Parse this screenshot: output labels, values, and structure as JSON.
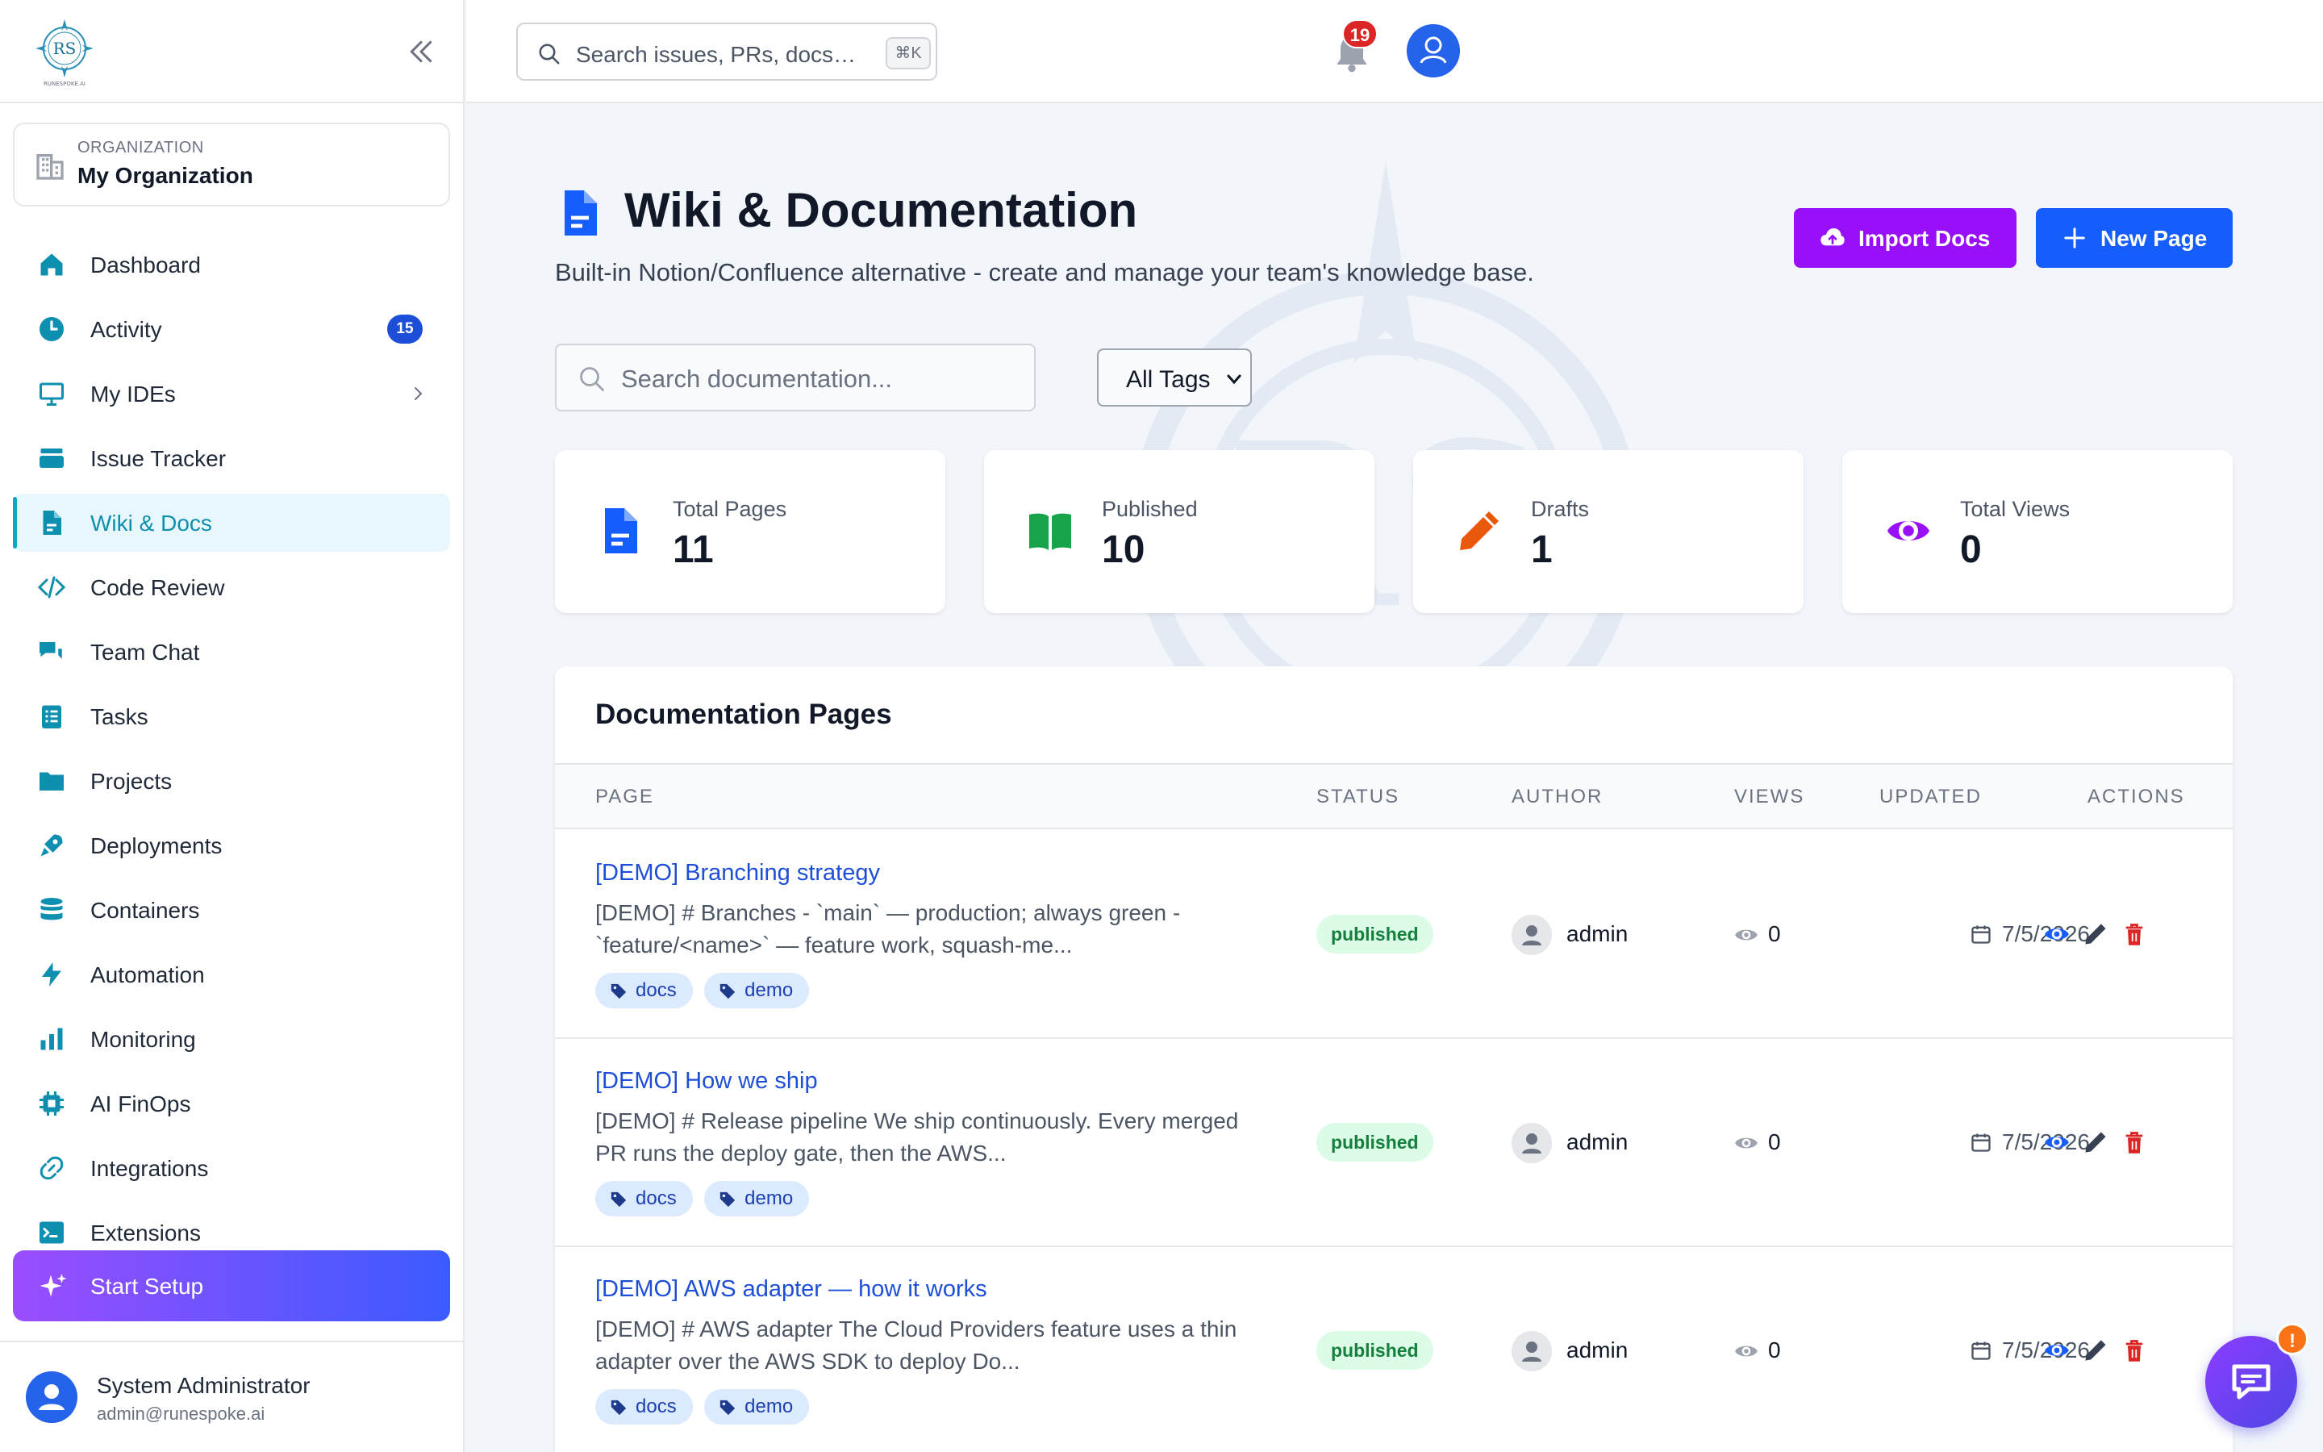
{
  "sidebar": {
    "logo_text": "RUNESPOKE.AI",
    "org": {
      "kicker": "ORGANIZATION",
      "name": "My Organization"
    },
    "items": [
      {
        "label": "Dashboard",
        "icon": "home-icon"
      },
      {
        "label": "Activity",
        "icon": "clock-icon",
        "badge": "15"
      },
      {
        "label": "My IDEs",
        "icon": "monitor-icon"
      },
      {
        "label": "Issue Tracker",
        "icon": "layers-icon"
      },
      {
        "label": "Wiki & Docs",
        "icon": "document-icon",
        "active": true
      },
      {
        "label": "Code Review",
        "icon": "code-icon"
      },
      {
        "label": "Team Chat",
        "icon": "chat-icon"
      },
      {
        "label": "Tasks",
        "icon": "tasks-icon"
      },
      {
        "label": "Projects",
        "icon": "folder-icon"
      },
      {
        "label": "Deployments",
        "icon": "rocket-icon"
      },
      {
        "label": "Containers",
        "icon": "database-icon"
      },
      {
        "label": "Automation",
        "icon": "bolt-icon"
      },
      {
        "label": "Monitoring",
        "icon": "bar-chart-icon"
      },
      {
        "label": "AI FinOps",
        "icon": "chip-icon"
      },
      {
        "label": "Integrations",
        "icon": "link-icon"
      },
      {
        "label": "Extensions",
        "icon": "terminal-icon"
      }
    ],
    "start_setup": "Start Setup",
    "user": {
      "name": "System Administrator",
      "email": "admin@runespoke.ai"
    }
  },
  "topbar": {
    "search_placeholder": "Search issues, PRs, docs…",
    "shortcut": "⌘K",
    "notifications": "19"
  },
  "page": {
    "title": "Wiki & Documentation",
    "subtitle": "Built-in Notion/Confluence alternative - create and manage your team's knowledge base.",
    "import_label": "Import Docs",
    "new_label": "New Page",
    "search_placeholder": "Search documentation...",
    "tag_filter": "All Tags"
  },
  "stats": [
    {
      "label": "Total Pages",
      "value": "11",
      "icon": "document-icon",
      "color": "#155dfc"
    },
    {
      "label": "Published",
      "value": "10",
      "icon": "book-icon",
      "color": "#16a34a"
    },
    {
      "label": "Drafts",
      "value": "1",
      "icon": "pencil-icon",
      "color": "#ea580c"
    },
    {
      "label": "Total Views",
      "value": "0",
      "icon": "eye-icon",
      "color": "#9810fa"
    }
  ],
  "table": {
    "title": "Documentation Pages",
    "headers": {
      "page": "PAGE",
      "status": "STATUS",
      "author": "AUTHOR",
      "views": "VIEWS",
      "updated": "UPDATED",
      "actions": "ACTIONS"
    },
    "rows": [
      {
        "title": "[DEMO] Branching strategy",
        "excerpt": "[DEMO] # Branches - `main` — production; always green - `feature/<name>` — feature work, squash-me...",
        "tags": [
          "docs",
          "demo"
        ],
        "status": "published",
        "author": "admin",
        "views": "0",
        "updated": "7/5/2026"
      },
      {
        "title": "[DEMO] How we ship",
        "excerpt": "[DEMO] # Release pipeline We ship continuously. Every merged PR runs the deploy gate, then the AWS...",
        "tags": [
          "docs",
          "demo"
        ],
        "status": "published",
        "author": "admin",
        "views": "0",
        "updated": "7/5/2026"
      },
      {
        "title": "[DEMO] AWS adapter — how it works",
        "excerpt": "[DEMO] # AWS adapter The Cloud Providers feature uses a thin adapter over the AWS SDK to deploy Do...",
        "tags": [
          "docs",
          "demo"
        ],
        "status": "published",
        "author": "admin",
        "views": "0",
        "updated": "7/5/2026"
      }
    ]
  },
  "chat_badge": "!",
  "colors": {
    "accent": "#0ea5c6",
    "primary": "#155dfc",
    "purple": "#9810fa",
    "danger": "#dc2626"
  }
}
